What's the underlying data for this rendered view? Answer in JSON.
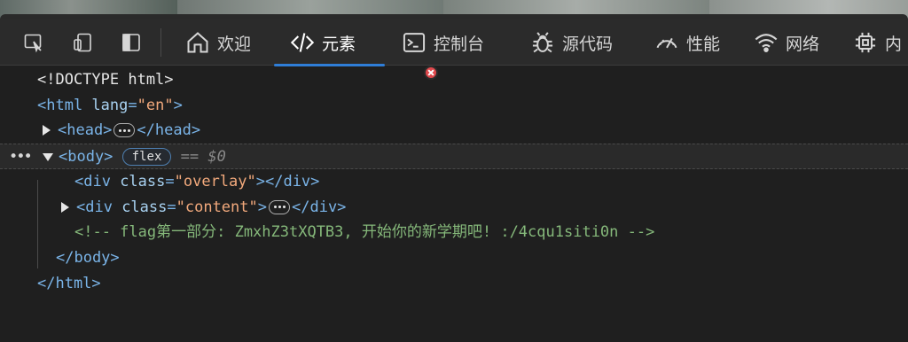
{
  "toolbar": {
    "tabs": [
      {
        "label": "欢迎",
        "icon": "home-icon"
      },
      {
        "label": "元素",
        "icon": "code-icon"
      },
      {
        "label": "控制台",
        "icon": "console-icon"
      },
      {
        "label": "源代码",
        "icon": "bug-icon"
      },
      {
        "label": "性能",
        "icon": "gauge-icon"
      },
      {
        "label": "网络",
        "icon": "wifi-icon"
      },
      {
        "label": "内",
        "icon": "chip-icon"
      }
    ],
    "active_tab": "元素",
    "accent": "#2f7ed8"
  },
  "dom": {
    "doctype": "<!DOCTYPE html>",
    "html_open": "<html",
    "html_attr": " lang",
    "html_eq": "=",
    "html_val": "\"en\"",
    "html_close_br": ">",
    "head_open": "<head>",
    "head_close": "</head>",
    "body_open": "<body>",
    "flex_badge": "flex",
    "selected_marker": "== $0",
    "div1_open": "<div",
    "div1_attr": " class",
    "div1_val": "\"overlay\"",
    "div1_end": "></div>",
    "div2_open": "<div",
    "div2_attr": " class",
    "div2_val": "\"content\"",
    "div2_gt": ">",
    "div2_close": "</div>",
    "comment": "<!-- flag第一部分: ZmxhZ3tXQTB3, 开始你的新学期吧! :/4cqu1siti0n -->",
    "body_close": "</body>",
    "html_close": "</html>"
  }
}
